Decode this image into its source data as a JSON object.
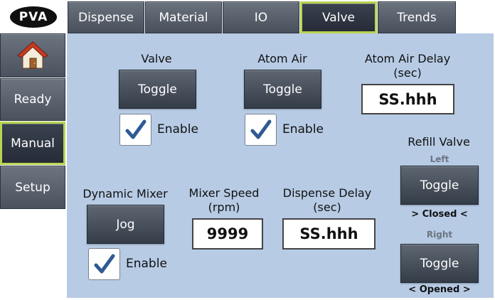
{
  "logo": {
    "text": "PVA"
  },
  "sidebar": {
    "items": [
      {
        "label": "",
        "icon": "home-icon"
      },
      {
        "label": "Ready"
      },
      {
        "label": "Manual"
      },
      {
        "label": "Setup"
      }
    ]
  },
  "tabs": [
    {
      "label": "Dispense"
    },
    {
      "label": "Material"
    },
    {
      "label": "IO"
    },
    {
      "label": "Valve"
    },
    {
      "label": "Trends"
    }
  ],
  "valve": {
    "title": "Valve",
    "toggle_label": "Toggle",
    "enable_label": "Enable",
    "enabled": true
  },
  "atom_air": {
    "title": "Atom Air",
    "toggle_label": "Toggle",
    "enable_label": "Enable",
    "enabled": true
  },
  "atom_air_delay": {
    "title_line1": "Atom Air Delay",
    "title_line2": "(sec)",
    "value": "SS.hhh"
  },
  "refill_valve": {
    "title": "Refill Valve",
    "left_label": "Left",
    "left_toggle": "Toggle",
    "left_state": "> Closed <",
    "right_label": "Right",
    "right_toggle": "Toggle",
    "right_state": "< Opened >"
  },
  "dynamic_mixer": {
    "title": "Dynamic Mixer",
    "jog_label": "Jog",
    "enable_label": "Enable",
    "enabled": true
  },
  "mixer_speed": {
    "title_line1": "Mixer Speed",
    "title_line2": "(rpm)",
    "value": "9999"
  },
  "dispense_delay": {
    "title_line1": "Dispense Delay",
    "title_line2": "(sec)",
    "value": "SS.hhh"
  },
  "colors": {
    "panel": "#b7cbe5",
    "active_border": "#b8d450",
    "button": "#4a525e",
    "check": "#2f5a94"
  }
}
